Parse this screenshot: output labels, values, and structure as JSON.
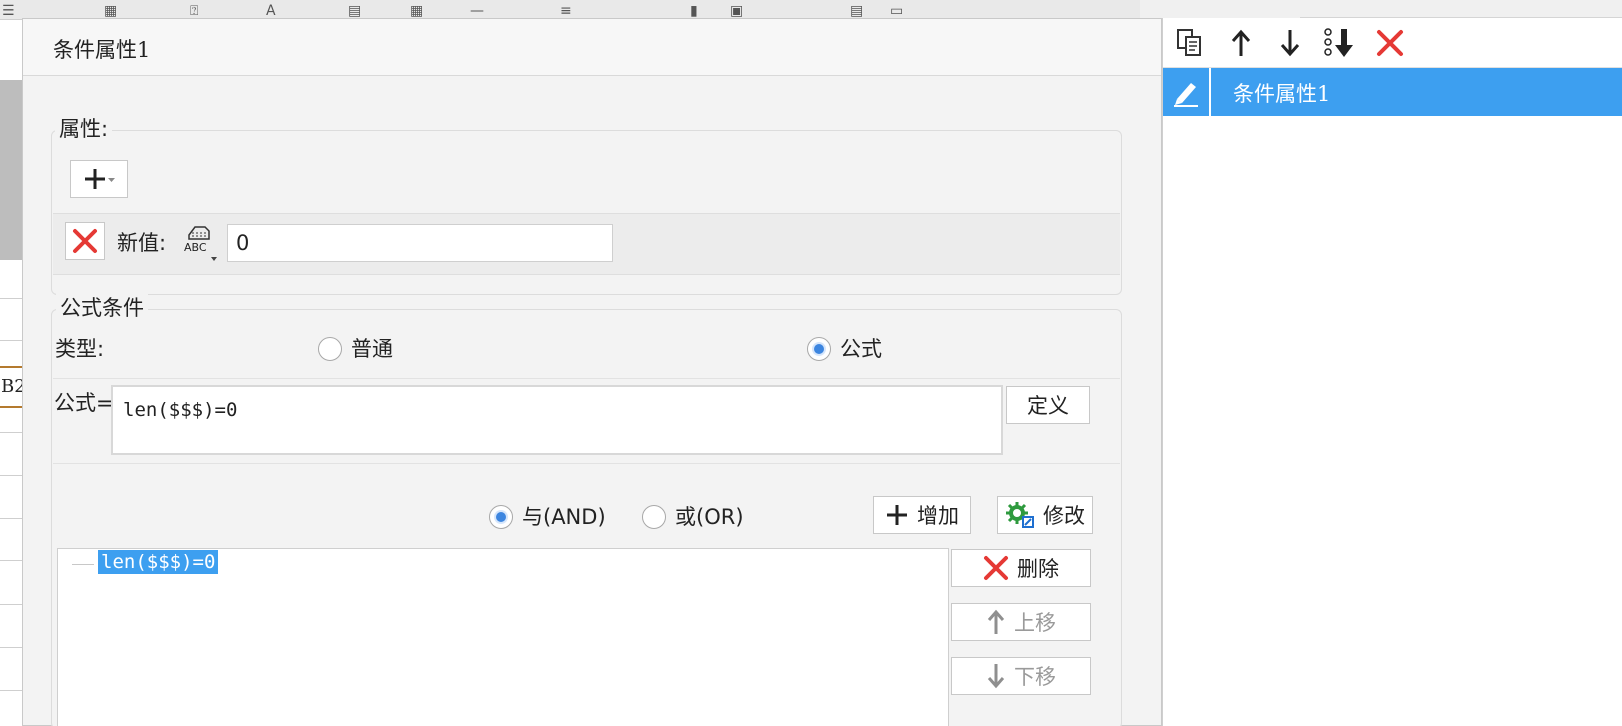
{
  "dialog": {
    "title": "条件属性1",
    "attributes_group": {
      "legend": "属性:",
      "new_value_label": "新值:",
      "new_value": "0"
    },
    "formula_group": {
      "legend": "公式条件",
      "type_label": "类型:",
      "type_options": [
        "普通",
        "公式"
      ],
      "type_selected": "公式",
      "formula_label": "公式=",
      "formula_value": "len($$$)=0",
      "define_button": "定义",
      "logic_options": [
        "与(AND)",
        "或(OR)"
      ],
      "logic_selected": "与(AND)",
      "add_button": "增加",
      "modify_button": "修改",
      "conditions": [
        "len($$$)=0"
      ],
      "delete_button": "删除",
      "move_up_button": "上移",
      "move_down_button": "下移"
    }
  },
  "right_panel": {
    "items": [
      "条件属性1"
    ],
    "selected_index": 0
  },
  "background": {
    "cell_ref": "B2"
  },
  "colors": {
    "selection": "#3d9ff0",
    "delete_red": "#e53935",
    "radio_checked": "#3d86e0"
  }
}
